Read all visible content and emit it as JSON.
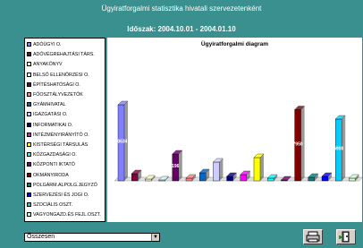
{
  "header": {
    "title": "Ügyiratforgalmi statisztika hivatali szervezetenként",
    "period": "Időszak: 2004.10.01 - 2004.01.10"
  },
  "legend": {
    "items": [
      {
        "label": "ADÓÜGYI O.",
        "color": "#8080ff"
      },
      {
        "label": "ADÓVÉGREHAJTÁSI TÁRS.",
        "color": "#800040"
      },
      {
        "label": "ANYAKÖNYV",
        "color": "#ffffcc"
      },
      {
        "label": "BELSŐ ELLENŐRZÉSI O.",
        "color": "#ccffff"
      },
      {
        "label": "ÉPÍTÉSHATÓSÁGI O.",
        "color": "#660066"
      },
      {
        "label": "FŐOSZTÁLYVEZETŐK",
        "color": "#ff8080"
      },
      {
        "label": "GYÁMHIVATAL",
        "color": "#0066cc"
      },
      {
        "label": "IGAZGATÁSI O.",
        "color": "#ccccff"
      },
      {
        "label": "INFORMATIKAI O.",
        "color": "#000080"
      },
      {
        "label": "INTÉZMÉNYIRÁNYÍTÓ O.",
        "color": "#ff00ff"
      },
      {
        "label": "KISTÉRSÉGI TÁRSULÁS",
        "color": "#ffff00"
      },
      {
        "label": "KÖZGAZDASÁGI O.",
        "color": "#00ffff"
      },
      {
        "label": "KÖZPONTI IKTATÓ",
        "color": "#800080"
      },
      {
        "label": "OKMÁNYIRODA",
        "color": "#800000"
      },
      {
        "label": "POLGÁRM.ALPOLG.JEGYZŐ",
        "color": "#008080"
      },
      {
        "label": "SZERVEZÉSI ÉS JOGI O.",
        "color": "#0000ff"
      },
      {
        "label": "SZOCIÁLIS OSZT.",
        "color": "#00ccff"
      },
      {
        "label": "VAGYONGAZD.ÉS FEJL.OSZT.",
        "color": "#ccffcc"
      }
    ]
  },
  "chart_data": {
    "type": "bar",
    "title": "Ügyiratforgalmi diagram",
    "categories": [
      "ADÓÜGYI O.",
      "ADÓVÉGREHAJTÁSI TÁRS.",
      "ANYAKÖNYV",
      "BELSŐ ELLENŐRZÉSI O.",
      "ÉPÍTÉSHATÓSÁGI O.",
      "FŐOSZTÁLYVEZETŐK",
      "GYÁMHIVATAL",
      "IGAZGATÁSI O.",
      "INFORMATIKAI O.",
      "INTÉZMÉNYIRÁNYÍTÓ O.",
      "KISTÉRSÉGI TÁRSULÁS",
      "KÖZGAZDASÁGI O.",
      "KÖZPONTI IKTATÓ",
      "OKMÁNYIRODA",
      "POLGÁRM.ALPOLG.JEGYZŐ",
      "SZERVEZÉSI ÉS JOGI O.",
      "SZOCIÁLIS OSZT.",
      "VAGYONGAZD.ÉS FEJL.OSZT."
    ],
    "values": [
      8500,
      800,
      200,
      100,
      3000,
      300,
      900,
      2100,
      500,
      700,
      2600,
      300,
      100,
      7950,
      400,
      500,
      6900,
      300
    ],
    "labels": [
      "10634",
      "",
      "",
      "",
      "196",
      "",
      "",
      "",
      "",
      "",
      "",
      "",
      "",
      "7950",
      "",
      "",
      "6900",
      ""
    ],
    "ylim": [
      0,
      10000
    ]
  },
  "footer": {
    "select_value": "Összesen",
    "select_arrow": "▼",
    "print_icon": "printer-icon",
    "exit_icon": "exit-door-icon"
  }
}
